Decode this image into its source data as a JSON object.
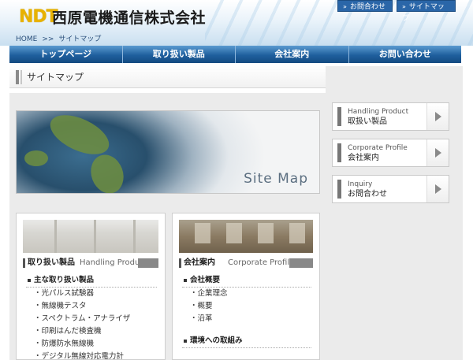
{
  "header": {
    "logo_mark": "NDT",
    "company_name": "西原電機通信株式会社",
    "top_links": [
      "お問合わせ",
      "サイトマップ"
    ],
    "breadcrumb": [
      "HOME",
      ">>",
      "サイトマップ"
    ]
  },
  "nav": [
    "トップページ",
    "取り扱い製品",
    "会社案内",
    "お問い合わせ"
  ],
  "page_title": "サイトマップ",
  "hero_caption": "Site Map",
  "side_buttons": [
    {
      "en": "Handling Product",
      "ja": "取扱い製品"
    },
    {
      "en": "Corporate Profile",
      "ja": "会社案内"
    },
    {
      "en": "Inquiry",
      "ja": "お問合わせ"
    }
  ],
  "products": {
    "title_ja": "取り扱い製品",
    "title_en": "Handling Product",
    "section": "主な取り扱い製品",
    "items": [
      "光パルス試験器",
      "無線機テスタ",
      "スペクトラム・アナライザ",
      "印刷はんだ検査機",
      "防爆防水無線機",
      "デジタル無線対応電力計"
    ]
  },
  "company": {
    "title_ja": "会社案内",
    "title_en": "Corporate Profile",
    "section": "会社概要",
    "items": [
      "企業理念",
      "概要",
      "沿革"
    ],
    "section2": "環境への取組み"
  }
}
